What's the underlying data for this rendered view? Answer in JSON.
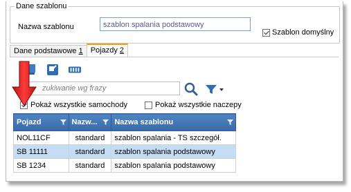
{
  "group": {
    "title": "Dane szablonu"
  },
  "name_field": {
    "label": "Nazwa szablonu",
    "value": "szablon spalania podstawowy"
  },
  "default_template": {
    "label": "Szablon domyślny",
    "checked": true
  },
  "tabs": [
    {
      "label": "Dane podstawowe",
      "key": "1",
      "active": false
    },
    {
      "label": "Pojazdy",
      "key": "2",
      "active": true
    }
  ],
  "toolbar": {
    "icons": [
      "add-icon",
      "edit-icon",
      "multi-link-icon"
    ]
  },
  "search": {
    "placeholder": "zukiwanie wg frazy"
  },
  "filters": {
    "show_all_vehicles": {
      "label": "Pokaż wszystkie samochody",
      "checked": true
    },
    "show_all_trailers": {
      "label": "Pokaż wszystkie naczepy",
      "checked": false
    }
  },
  "grid": {
    "headers": [
      "Pojazd",
      "Nazw...",
      "Nazwa szablonu"
    ],
    "rows": [
      {
        "vehicle": "NOL11CF",
        "type": "standard",
        "template": "szablon spalania - TS szczegół.",
        "selected": false
      },
      {
        "vehicle": "SB 11111",
        "type": "standard",
        "template": "szablon spalania podstawowy",
        "selected": true
      },
      {
        "vehicle": "SB 1234",
        "type": "standard",
        "template": "szablon spalania podstawowy",
        "selected": false
      }
    ]
  },
  "colors": {
    "header_blue": "#3a6aa8",
    "selected_row": "#c5dcf5",
    "arrow_red": "#e02020",
    "tab_accent": "#f0a000"
  }
}
